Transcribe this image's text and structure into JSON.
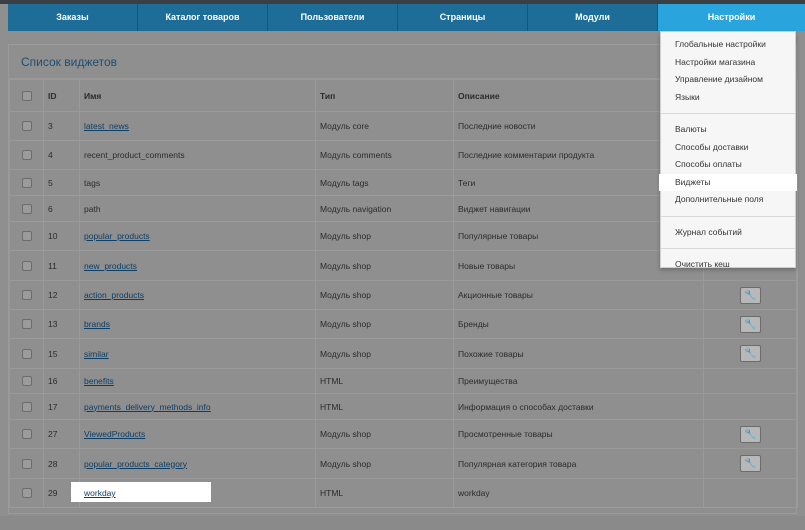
{
  "nav": [
    {
      "label": "Заказы",
      "width": 130
    },
    {
      "label": "Каталог товаров",
      "width": 130
    },
    {
      "label": "Пользователи",
      "width": 130
    },
    {
      "label": "Страницы",
      "width": 130
    },
    {
      "label": "Модули",
      "width": 130
    },
    {
      "label": "Настройки",
      "width": 147
    }
  ],
  "panel_title": "Список виджетов",
  "columns": {
    "id": "ID",
    "name": "Имя",
    "type": "Тип",
    "description": "Описание"
  },
  "rows": [
    {
      "id": "3",
      "name": "latest_news",
      "link": true,
      "type": "Модуль core",
      "description": "Последние новости",
      "action": false
    },
    {
      "id": "4",
      "name": "recent_product_comments",
      "link": false,
      "type": "Модуль comments",
      "description": "Последние комментарии продукта",
      "action": false
    },
    {
      "id": "5",
      "name": "tags",
      "link": false,
      "type": "Модуль tags",
      "description": "Теги",
      "action": false
    },
    {
      "id": "6",
      "name": "path",
      "link": false,
      "type": "Модуль navigation",
      "description": "Виджет навигации",
      "action": false
    },
    {
      "id": "10",
      "name": "popular_products",
      "link": true,
      "type": "Модуль shop",
      "description": "Популярные товары",
      "action": false
    },
    {
      "id": "11",
      "name": "new_products",
      "link": true,
      "type": "Модуль shop",
      "description": "Новые товары",
      "action": false
    },
    {
      "id": "12",
      "name": "action_products",
      "link": true,
      "type": "Модуль shop",
      "description": "Акционные товары",
      "action": true
    },
    {
      "id": "13",
      "name": "brands",
      "link": true,
      "type": "Модуль shop",
      "description": "Бренды",
      "action": true
    },
    {
      "id": "15",
      "name": "similar",
      "link": true,
      "type": "Модуль shop",
      "description": "Похожие товары",
      "action": true
    },
    {
      "id": "16",
      "name": "benefits",
      "link": true,
      "type": "HTML",
      "description": "Преимущества",
      "action": false
    },
    {
      "id": "17",
      "name": "payments_delivery_methods_info",
      "link": true,
      "type": "HTML",
      "description": "Информация о способах доставки",
      "action": false
    },
    {
      "id": "27",
      "name": "ViewedProducts",
      "link": true,
      "type": "Модуль shop",
      "description": "Просмотренные товары",
      "action": true
    },
    {
      "id": "28",
      "name": "popular_products_category",
      "link": true,
      "type": "Модуль shop",
      "description": "Популярная категория товара",
      "action": true
    },
    {
      "id": "29",
      "name": "workday",
      "link": true,
      "type": "HTML",
      "description": "workday",
      "action": false
    }
  ],
  "menu": {
    "group1": [
      "Глобальные настройки",
      "Настройки магазина",
      "Управление дизайном",
      "Языки"
    ],
    "group2": [
      "Валюты",
      "Способы доставки",
      "Способы оплаты",
      "Виджеты",
      "Дополнительные поля"
    ],
    "group3": [
      "Журнал событий"
    ],
    "group4": [
      "Очистить кеш"
    ],
    "highlighted": "Виджеты"
  },
  "wrench_glyph": "🔧",
  "colors": {
    "nav_bg": "#1e6c98",
    "nav_active": "#29a4dc",
    "link": "#0c3e66",
    "overlay": "#8f8f8f"
  }
}
